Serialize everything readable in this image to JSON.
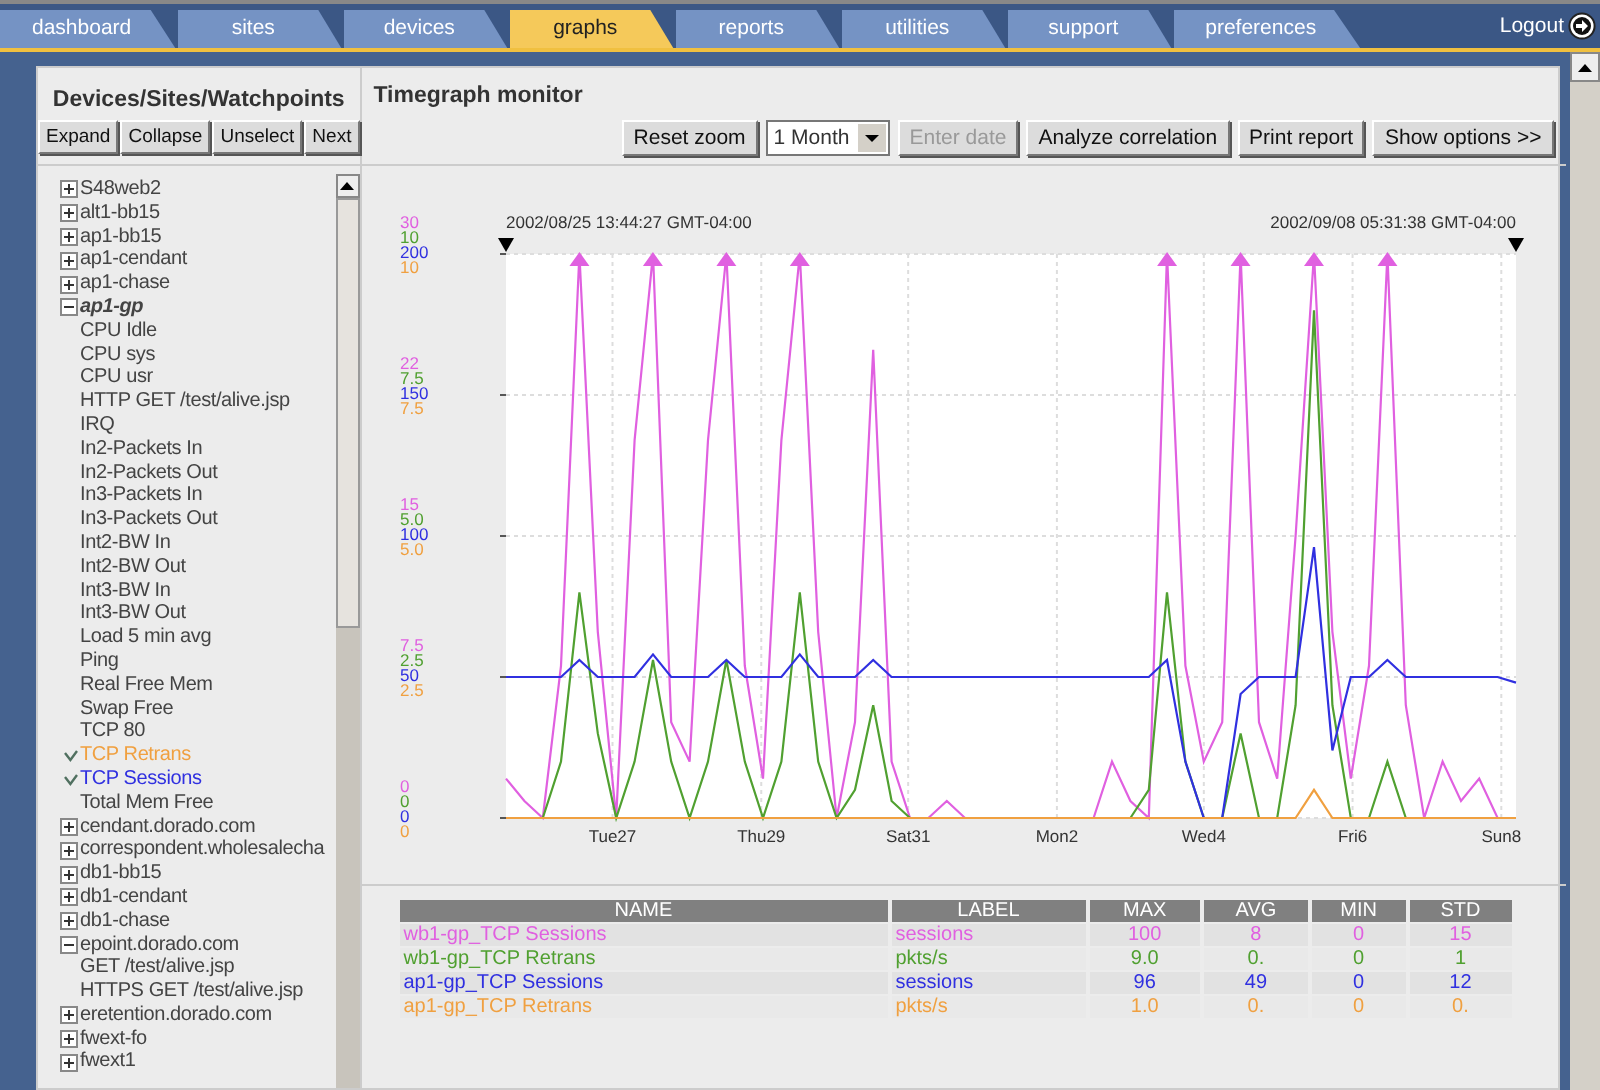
{
  "tabs": [
    {
      "label": "dashboard",
      "selected": false
    },
    {
      "label": "sites",
      "selected": false
    },
    {
      "label": "devices",
      "selected": false
    },
    {
      "label": "graphs",
      "selected": true
    },
    {
      "label": "reports",
      "selected": false
    },
    {
      "label": "utilities",
      "selected": false
    },
    {
      "label": "support",
      "selected": false
    },
    {
      "label": "preferences",
      "selected": false
    }
  ],
  "logout": "Logout",
  "sidebar": {
    "title": "Devices/Sites/Watchpoints",
    "buttons": [
      "Expand",
      "Collapse",
      "Unselect",
      "Next"
    ],
    "items": [
      {
        "label": "S48web2",
        "expanded": false,
        "selected": false
      },
      {
        "label": "alt1-bb15",
        "expanded": false,
        "selected": false
      },
      {
        "label": "ap1-bb15",
        "expanded": false,
        "selected": false
      },
      {
        "label": "ap1-cendant",
        "expanded": false,
        "selected": false
      },
      {
        "label": "ap1-chase",
        "expanded": false,
        "selected": false
      },
      {
        "label": "ap1-gp",
        "expanded": true,
        "selected": true,
        "children": [
          {
            "label": "CPU Idle",
            "checked": false
          },
          {
            "label": "CPU sys",
            "checked": false
          },
          {
            "label": "CPU usr",
            "checked": false
          },
          {
            "label": "HTTP GET /test/alive.jsp",
            "checked": false
          },
          {
            "label": "IRQ",
            "checked": false
          },
          {
            "label": "In2-Packets In",
            "checked": false
          },
          {
            "label": "In2-Packets Out",
            "checked": false
          },
          {
            "label": "In3-Packets In",
            "checked": false
          },
          {
            "label": "In3-Packets Out",
            "checked": false
          },
          {
            "label": "Int2-BW In",
            "checked": false
          },
          {
            "label": "Int2-BW Out",
            "checked": false
          },
          {
            "label": "Int3-BW In",
            "checked": false
          },
          {
            "label": "Int3-BW Out",
            "checked": false
          },
          {
            "label": "Load 5 min avg",
            "checked": false
          },
          {
            "label": "Ping",
            "checked": false
          },
          {
            "label": "Real Free Mem",
            "checked": false
          },
          {
            "label": "Swap Free",
            "checked": false
          },
          {
            "label": "TCP 80",
            "checked": false
          },
          {
            "label": "TCP Retrans",
            "checked": true,
            "color": "#f0a040"
          },
          {
            "label": "TCP Sessions",
            "checked": true,
            "color": "#3030e0"
          },
          {
            "label": "Total Mem Free",
            "checked": false
          }
        ]
      },
      {
        "label": "cendant.dorado.com",
        "expanded": false,
        "selected": false
      },
      {
        "label": "correspondent.wholesalecha",
        "expanded": false,
        "selected": false
      },
      {
        "label": "db1-bb15",
        "expanded": false,
        "selected": false
      },
      {
        "label": "db1-cendant",
        "expanded": false,
        "selected": false
      },
      {
        "label": "db1-chase",
        "expanded": false,
        "selected": false
      },
      {
        "label": "epoint.dorado.com",
        "expanded": true,
        "selected": false,
        "children": [
          {
            "label": "GET /test/alive.jsp",
            "checked": false
          },
          {
            "label": "HTTPS GET /test/alive.jsp",
            "checked": false
          }
        ]
      },
      {
        "label": "eretention.dorado.com",
        "expanded": false,
        "selected": false
      },
      {
        "label": "fwext-fo",
        "expanded": false,
        "selected": false
      },
      {
        "label": "fwext1",
        "expanded": false,
        "selected": false
      }
    ]
  },
  "main": {
    "title": "Timegraph monitor",
    "reset_button": "Reset zoom",
    "range_select": "1 Month",
    "date_button": {
      "label": "Enter date",
      "disabled": true
    },
    "buttons": [
      "Analyze correlation",
      "Print report",
      "Show options >>"
    ]
  },
  "chart": {
    "start_label": "2002/08/25 13:44:27 GMT-04:00",
    "end_label": "2002/09/08 05:31:38 GMT-04:00",
    "scales": [
      {
        "color": "#e060e0",
        "labels": [
          "30",
          "22",
          "15",
          "7.5",
          "0"
        ]
      },
      {
        "color": "#50a030",
        "labels": [
          "10",
          "7.5",
          "5.0",
          "2.5",
          "0"
        ]
      },
      {
        "color": "#3030e0",
        "labels": [
          "200",
          "150",
          "100",
          "50",
          "0"
        ]
      },
      {
        "color": "#f0a040",
        "labels": [
          "10",
          "7.5",
          "5.0",
          "2.5",
          "0"
        ]
      }
    ],
    "x_labels": [
      "Tue27",
      "Thu29",
      "Sat31",
      "Mon2",
      "Wed4",
      "Fri6",
      "Sun8"
    ]
  },
  "table": {
    "columns": [
      "NAME",
      "LABEL",
      "MAX",
      "AVG",
      "MIN",
      "STD"
    ],
    "rows": [
      {
        "color": "#e060e0",
        "cells": [
          "wb1-gp_TCP Sessions",
          "sessions",
          "100",
          "8",
          "0",
          "15"
        ]
      },
      {
        "color": "#50a030",
        "cells": [
          "wb1-gp_TCP Retrans",
          "pkts/s",
          "9.0",
          "0.",
          "0",
          "1"
        ]
      },
      {
        "color": "#3030e0",
        "cells": [
          "ap1-gp_TCP Sessions",
          "sessions",
          "96",
          "49",
          "0",
          "12"
        ]
      },
      {
        "color": "#f0a040",
        "cells": [
          "ap1-gp_TCP Retrans",
          "pkts/s",
          "1.0",
          "0.",
          "0",
          "0."
        ]
      }
    ]
  }
}
